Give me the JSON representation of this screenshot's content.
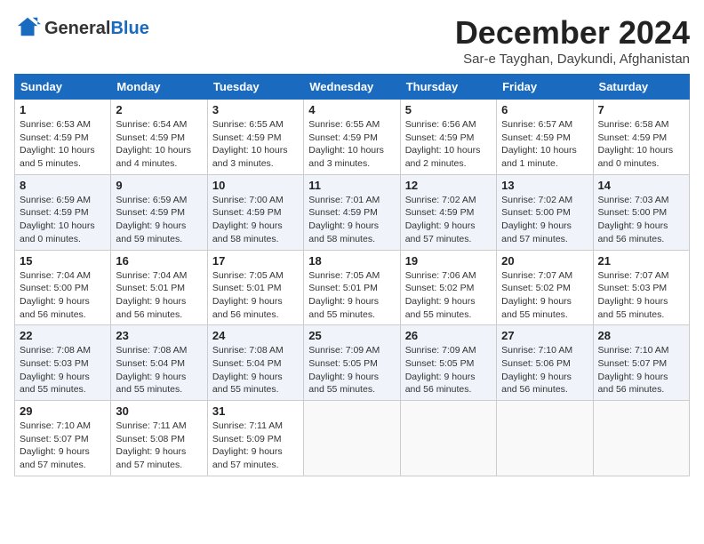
{
  "logo": {
    "general": "General",
    "blue": "Blue"
  },
  "title": "December 2024",
  "location": "Sar-e Tayghan, Daykundi, Afghanistan",
  "days_of_week": [
    "Sunday",
    "Monday",
    "Tuesday",
    "Wednesday",
    "Thursday",
    "Friday",
    "Saturday"
  ],
  "weeks": [
    [
      {
        "day": "1",
        "sunrise": "6:53 AM",
        "sunset": "4:59 PM",
        "daylight": "10 hours and 5 minutes."
      },
      {
        "day": "2",
        "sunrise": "6:54 AM",
        "sunset": "4:59 PM",
        "daylight": "10 hours and 4 minutes."
      },
      {
        "day": "3",
        "sunrise": "6:55 AM",
        "sunset": "4:59 PM",
        "daylight": "10 hours and 3 minutes."
      },
      {
        "day": "4",
        "sunrise": "6:55 AM",
        "sunset": "4:59 PM",
        "daylight": "10 hours and 3 minutes."
      },
      {
        "day": "5",
        "sunrise": "6:56 AM",
        "sunset": "4:59 PM",
        "daylight": "10 hours and 2 minutes."
      },
      {
        "day": "6",
        "sunrise": "6:57 AM",
        "sunset": "4:59 PM",
        "daylight": "10 hours and 1 minute."
      },
      {
        "day": "7",
        "sunrise": "6:58 AM",
        "sunset": "4:59 PM",
        "daylight": "10 hours and 0 minutes."
      }
    ],
    [
      {
        "day": "8",
        "sunrise": "6:59 AM",
        "sunset": "4:59 PM",
        "daylight": "10 hours and 0 minutes."
      },
      {
        "day": "9",
        "sunrise": "6:59 AM",
        "sunset": "4:59 PM",
        "daylight": "9 hours and 59 minutes."
      },
      {
        "day": "10",
        "sunrise": "7:00 AM",
        "sunset": "4:59 PM",
        "daylight": "9 hours and 58 minutes."
      },
      {
        "day": "11",
        "sunrise": "7:01 AM",
        "sunset": "4:59 PM",
        "daylight": "9 hours and 58 minutes."
      },
      {
        "day": "12",
        "sunrise": "7:02 AM",
        "sunset": "4:59 PM",
        "daylight": "9 hours and 57 minutes."
      },
      {
        "day": "13",
        "sunrise": "7:02 AM",
        "sunset": "5:00 PM",
        "daylight": "9 hours and 57 minutes."
      },
      {
        "day": "14",
        "sunrise": "7:03 AM",
        "sunset": "5:00 PM",
        "daylight": "9 hours and 56 minutes."
      }
    ],
    [
      {
        "day": "15",
        "sunrise": "7:04 AM",
        "sunset": "5:00 PM",
        "daylight": "9 hours and 56 minutes."
      },
      {
        "day": "16",
        "sunrise": "7:04 AM",
        "sunset": "5:01 PM",
        "daylight": "9 hours and 56 minutes."
      },
      {
        "day": "17",
        "sunrise": "7:05 AM",
        "sunset": "5:01 PM",
        "daylight": "9 hours and 56 minutes."
      },
      {
        "day": "18",
        "sunrise": "7:05 AM",
        "sunset": "5:01 PM",
        "daylight": "9 hours and 55 minutes."
      },
      {
        "day": "19",
        "sunrise": "7:06 AM",
        "sunset": "5:02 PM",
        "daylight": "9 hours and 55 minutes."
      },
      {
        "day": "20",
        "sunrise": "7:07 AM",
        "sunset": "5:02 PM",
        "daylight": "9 hours and 55 minutes."
      },
      {
        "day": "21",
        "sunrise": "7:07 AM",
        "sunset": "5:03 PM",
        "daylight": "9 hours and 55 minutes."
      }
    ],
    [
      {
        "day": "22",
        "sunrise": "7:08 AM",
        "sunset": "5:03 PM",
        "daylight": "9 hours and 55 minutes."
      },
      {
        "day": "23",
        "sunrise": "7:08 AM",
        "sunset": "5:04 PM",
        "daylight": "9 hours and 55 minutes."
      },
      {
        "day": "24",
        "sunrise": "7:08 AM",
        "sunset": "5:04 PM",
        "daylight": "9 hours and 55 minutes."
      },
      {
        "day": "25",
        "sunrise": "7:09 AM",
        "sunset": "5:05 PM",
        "daylight": "9 hours and 55 minutes."
      },
      {
        "day": "26",
        "sunrise": "7:09 AM",
        "sunset": "5:05 PM",
        "daylight": "9 hours and 56 minutes."
      },
      {
        "day": "27",
        "sunrise": "7:10 AM",
        "sunset": "5:06 PM",
        "daylight": "9 hours and 56 minutes."
      },
      {
        "day": "28",
        "sunrise": "7:10 AM",
        "sunset": "5:07 PM",
        "daylight": "9 hours and 56 minutes."
      }
    ],
    [
      {
        "day": "29",
        "sunrise": "7:10 AM",
        "sunset": "5:07 PM",
        "daylight": "9 hours and 57 minutes."
      },
      {
        "day": "30",
        "sunrise": "7:11 AM",
        "sunset": "5:08 PM",
        "daylight": "9 hours and 57 minutes."
      },
      {
        "day": "31",
        "sunrise": "7:11 AM",
        "sunset": "5:09 PM",
        "daylight": "9 hours and 57 minutes."
      },
      null,
      null,
      null,
      null
    ]
  ],
  "labels": {
    "sunrise": "Sunrise:",
    "sunset": "Sunset:",
    "daylight": "Daylight:"
  }
}
